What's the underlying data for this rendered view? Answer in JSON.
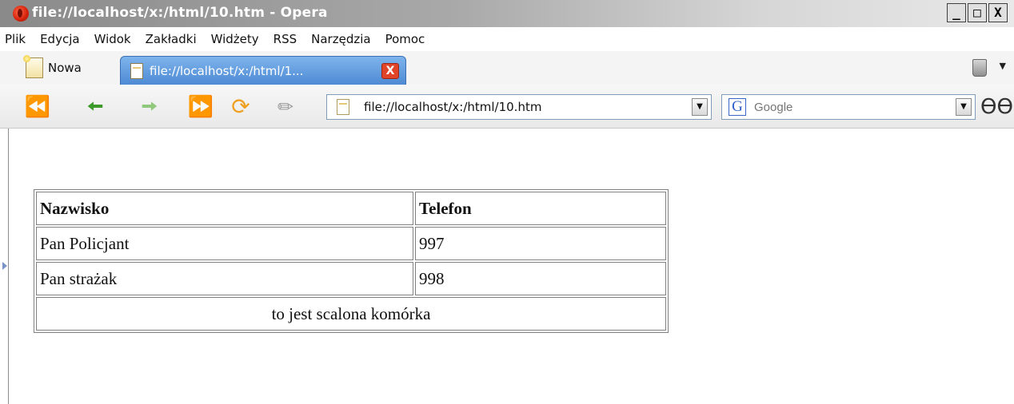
{
  "window": {
    "title": "file://localhost/x:/html/10.htm - Opera",
    "buttons": [
      "_",
      "□",
      "X"
    ]
  },
  "menu": [
    "Plik",
    "Edycja",
    "Widok",
    "Zakładki",
    "Widżety",
    "RSS",
    "Narzędzia",
    "Pomoc"
  ],
  "tabs": {
    "new_label": "Nowa",
    "active_title": "file://localhost/x:/html/1...",
    "close_glyph": "X"
  },
  "toolbar": {
    "address": "file://localhost/x:/html/10.htm",
    "search_placeholder": "Google",
    "search_engine_letter": "G"
  },
  "table": {
    "header": [
      "Nazwisko",
      "Telefon"
    ],
    "rows": [
      [
        "Pan Policjant",
        "997"
      ],
      [
        "Pan strażak",
        "998"
      ]
    ],
    "merged_cell": "to jest scalona komórka"
  },
  "colors": {
    "tab_active": "#5a93d8",
    "opera_red": "#d8250e",
    "close_button": "#e0452a"
  }
}
